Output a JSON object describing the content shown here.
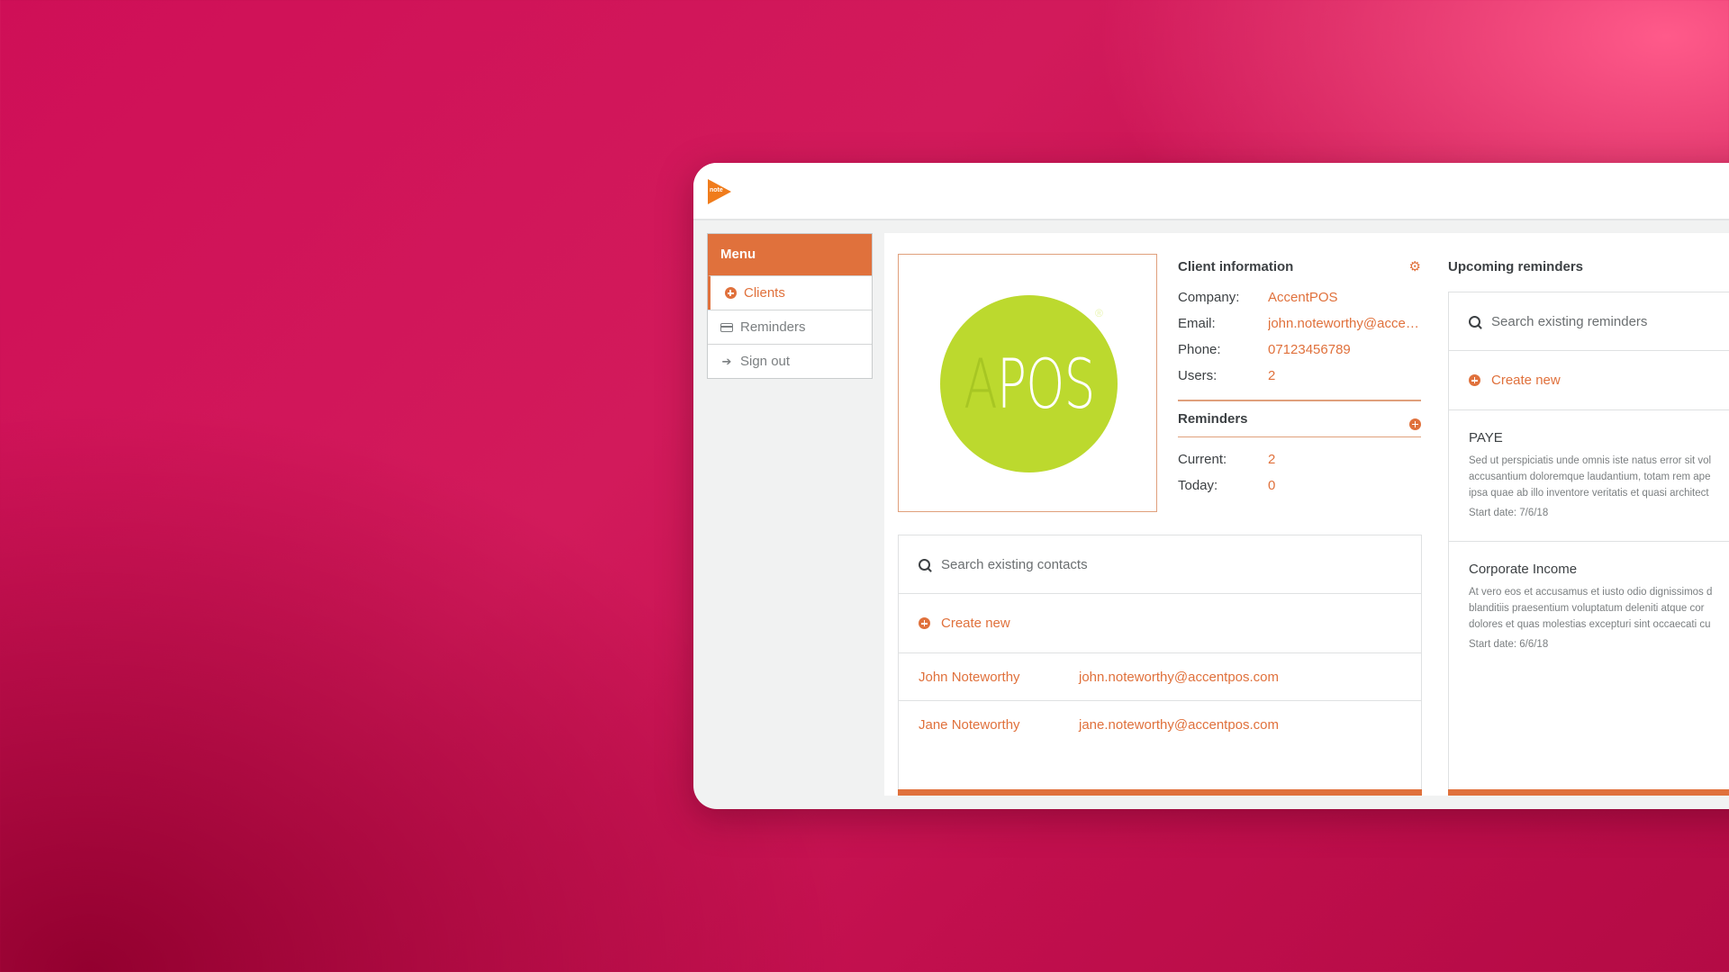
{
  "app": {
    "logo_text": "note"
  },
  "menu": {
    "title": "Menu",
    "items": [
      {
        "label": "Clients",
        "icon": "plus-circle-icon",
        "active": true
      },
      {
        "label": "Reminders",
        "icon": "card-icon",
        "active": false
      },
      {
        "label": "Sign out",
        "icon": "sign-out-icon",
        "active": false
      }
    ]
  },
  "client_logo": {
    "letters_faint": "A",
    "letters_main": "POS",
    "reg_mark": "®"
  },
  "client_info": {
    "title": "Client information",
    "fields": [
      {
        "label": "Company:",
        "value": "AccentPOS"
      },
      {
        "label": "Email:",
        "value": "john.noteworthy@accentpos.com"
      },
      {
        "label": "Phone:",
        "value": "07123456789"
      },
      {
        "label": "Users:",
        "value": "2"
      }
    ]
  },
  "reminders_summary": {
    "title": "Reminders",
    "fields": [
      {
        "label": "Current:",
        "value": "2"
      },
      {
        "label": "Today:",
        "value": "0"
      }
    ]
  },
  "contacts": {
    "search_placeholder": "Search existing contacts",
    "create_label": "Create new",
    "rows": [
      {
        "name": "John Noteworthy",
        "email": "john.noteworthy@accentpos.com"
      },
      {
        "name": "Jane Noteworthy",
        "email": "jane.noteworthy@accentpos.com"
      }
    ]
  },
  "upcoming": {
    "title": "Upcoming reminders",
    "search_placeholder": "Search existing reminders",
    "create_label": "Create new",
    "items": [
      {
        "title": "PAYE",
        "desc": [
          "Sed ut perspiciatis unde omnis iste natus error sit vol",
          "accusantium doloremque laudantium, totam rem ape",
          "ipsa quae ab illo inventore veritatis et quasi architect"
        ],
        "start": "Start date: 7/6/18"
      },
      {
        "title": "Corporate Income",
        "desc": [
          "At vero eos et accusamus et iusto odio dignissimos d",
          "blanditiis praesentium voluptatum deleniti atque cor",
          "dolores et quas molestias excepturi sint occaecati cu"
        ],
        "start": "Start date: 6/6/18"
      }
    ]
  },
  "colors": {
    "accent": "#e0713c",
    "logo_green": "#bcd92e",
    "background": "#cf0f57"
  }
}
